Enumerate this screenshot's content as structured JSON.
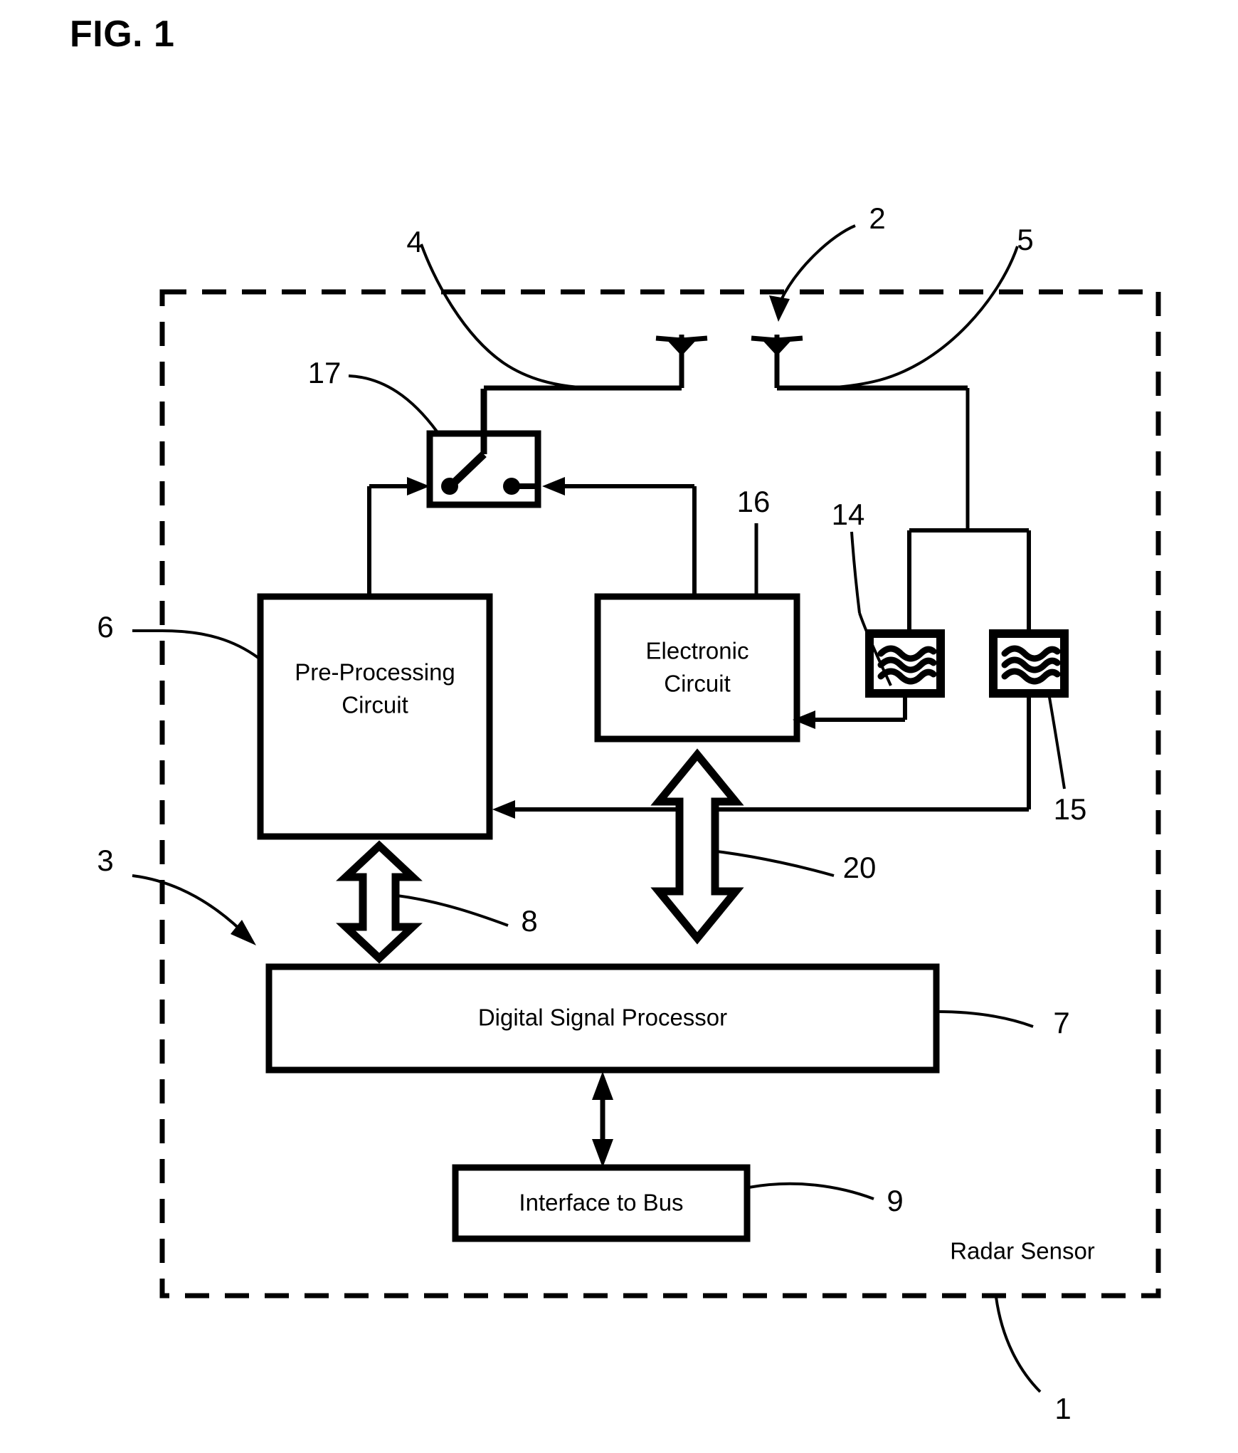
{
  "figure": {
    "label": "FIG. 1",
    "enclosure_label": "Radar Sensor"
  },
  "blocks": [
    {
      "id": "pre_processing",
      "label_line1": "Pre-Processing",
      "label_line2": "Circuit",
      "ref": "6"
    },
    {
      "id": "electronic",
      "label_line1": "Electronic",
      "label_line2": "Circuit",
      "ref": "16"
    },
    {
      "id": "dsp",
      "label_line1": "Digital Signal Processor",
      "label_line2": "",
      "ref": "7"
    },
    {
      "id": "interface",
      "label_line1": "Interface to Bus",
      "label_line2": "",
      "ref": "9"
    }
  ],
  "reference_numerals": {
    "n1": "1",
    "n2": "2",
    "n3": "3",
    "n4": "4",
    "n5": "5",
    "n6": "6",
    "n7": "7",
    "n8": "8",
    "n9": "9",
    "n14": "14",
    "n15": "15",
    "n16": "16",
    "n17": "17",
    "n20": "20"
  },
  "components": {
    "antenna_tx": "antenna-symbol",
    "antenna_rx": "antenna-symbol",
    "switch": "spdt-switch-symbol",
    "oscillator_14": "wave-symbol",
    "oscillator_15": "wave-symbol"
  },
  "colors": {
    "line": "#000000",
    "background": "#ffffff"
  }
}
